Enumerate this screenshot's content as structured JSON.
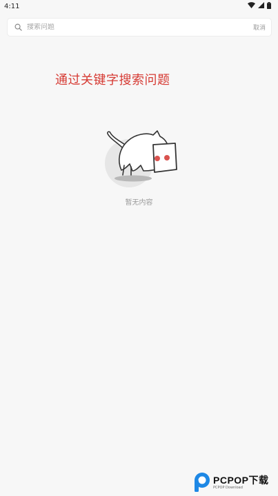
{
  "status_bar": {
    "time": "4:11"
  },
  "search": {
    "placeholder": "搜索问题",
    "cancel_label": "取消"
  },
  "hint": {
    "text": "通过关键字搜索问题",
    "color": "#d63a33"
  },
  "empty_state": {
    "text": "暂无内容",
    "icon": "cat-box-illustration"
  },
  "watermark": {
    "brand": "PCPOP下载",
    "sub": "PCPOP Download"
  },
  "colors": {
    "background": "#f7f7f7",
    "accent_red": "#d63a33",
    "muted_text": "#9a9a9a"
  }
}
